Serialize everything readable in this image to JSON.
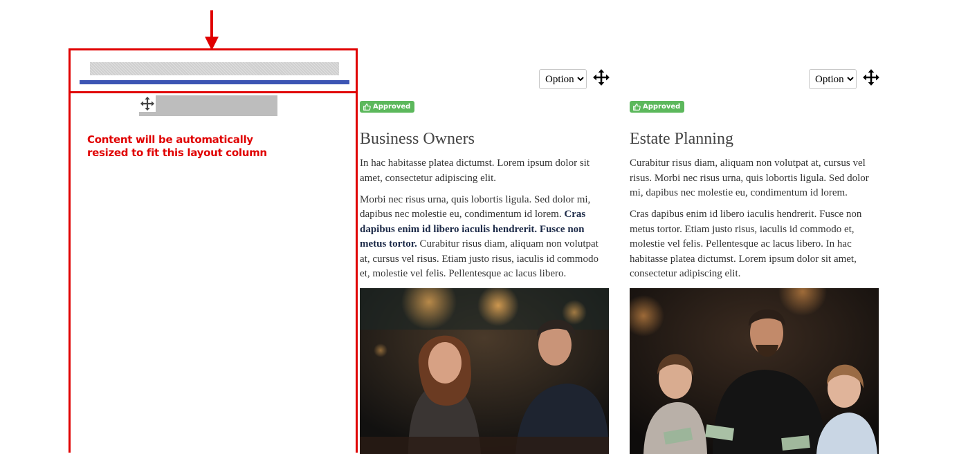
{
  "layout_column": {
    "note": "Content will be automatically\nresized to fit this layout column",
    "note_line1": "Content will be automatically",
    "note_line2": "resized to fit this layout column"
  },
  "cards": [
    {
      "options_label": "Options",
      "badge": "Approved",
      "title": "Business Owners",
      "p1": "In hac habitasse platea dictumst. Lorem ipsum dolor sit amet, consectetur adipiscing elit.",
      "p2_start": "Morbi nec risus urna, quis lobortis ligula. Sed dolor mi, dapibus nec molestie eu, condimentum id lorem.",
      "p2_bold": "Cras dapibus enim id libero iaculis hendrerit. Fusce non metus tortor.",
      "p2_end": "Curabitur risus diam, aliquam non volutpat at, cursus vel risus. Etiam justo risus, iaculis id commodo et, molestie vel felis. Pellentesque ac lacus libero."
    },
    {
      "options_label": "Options",
      "badge": "Approved",
      "title": "Estate Planning",
      "p1": "Curabitur risus diam, aliquam non volutpat at, cursus vel risus. Morbi nec risus urna, quis lobortis ligula. Sed dolor mi, dapibus nec molestie eu, condimentum id lorem.",
      "p2": "Cras dapibus enim id libero iaculis hendrerit. Fusce non metus tortor. Etiam justo risus, iaculis id commodo et, molestie vel felis. Pellentesque ac lacus libero. In hac habitasse platea dictumst. Lorem ipsum dolor sit amet, consectetur adipiscing elit."
    }
  ],
  "icons": {
    "arrow": "arrow-down-icon",
    "move": "move-icon",
    "thumbs_up": "thumbs-up-icon",
    "chevron": "chevron-down-icon"
  },
  "colors": {
    "annotation_red": "#e00000",
    "drop_bar": "#3c55b4",
    "badge_green": "#5cb85c"
  }
}
